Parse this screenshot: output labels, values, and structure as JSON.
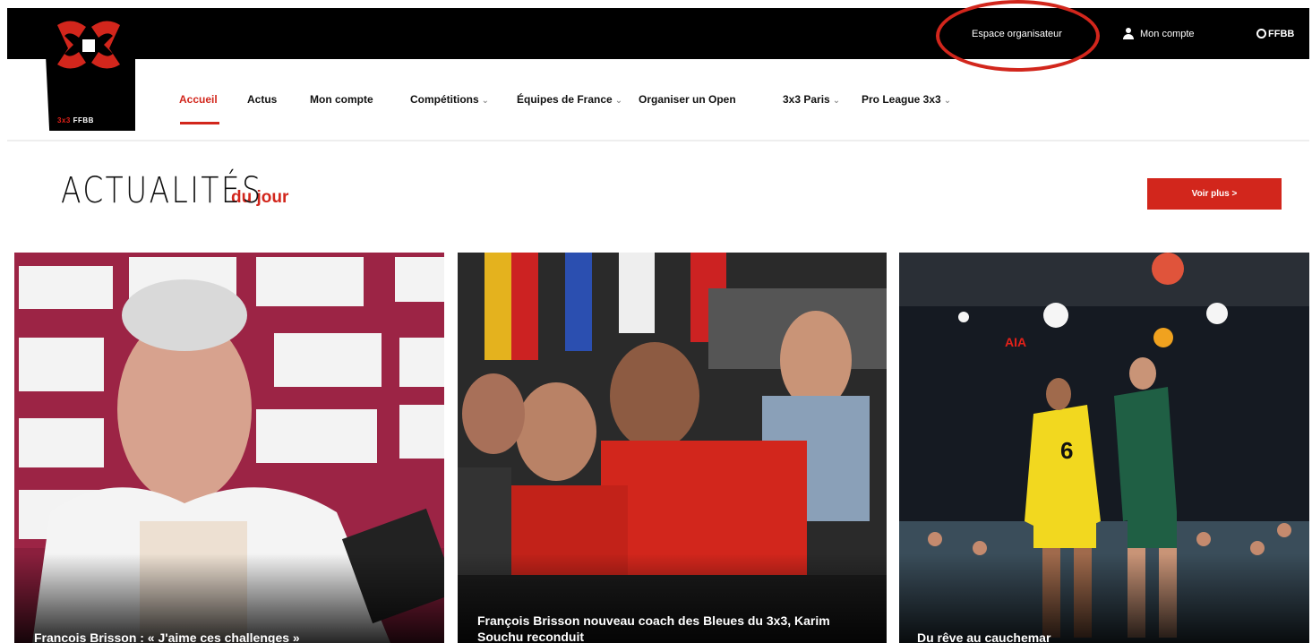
{
  "topbar": {
    "organizer_link": "Espace organisateur",
    "account_link": "Mon compte",
    "ffbb_label": "FFBB"
  },
  "logo": {
    "brand_prefix": "3x3",
    "brand_suffix": "FFBB"
  },
  "nav": {
    "items": [
      {
        "label": "Accueil",
        "dropdown": false,
        "active": true
      },
      {
        "label": "Actus",
        "dropdown": false
      },
      {
        "label": "Mon compte",
        "dropdown": false
      },
      {
        "label": "Compétitions",
        "dropdown": true
      },
      {
        "label": "Équipes de France",
        "dropdown": true
      },
      {
        "label": "Organiser un Open",
        "dropdown": false
      },
      {
        "label": "3x3 Paris",
        "dropdown": true
      },
      {
        "label": "Pro League 3x3",
        "dropdown": true
      }
    ],
    "chevron": "⌄"
  },
  "section": {
    "title_main": "ACTUALITÉS",
    "title_sub": "du jour",
    "more_button": "Voir plus >"
  },
  "cards": [
    {
      "caption": "Francois Brisson : « J'aime ces challenges »"
    },
    {
      "caption": "François Brisson nouveau coach des Bleues du 3x3, Karim Souchu reconduit"
    },
    {
      "caption": "Du rêve au cauchemar"
    }
  ],
  "colors": {
    "accent": "#d2261c",
    "topbar": "#000000"
  }
}
